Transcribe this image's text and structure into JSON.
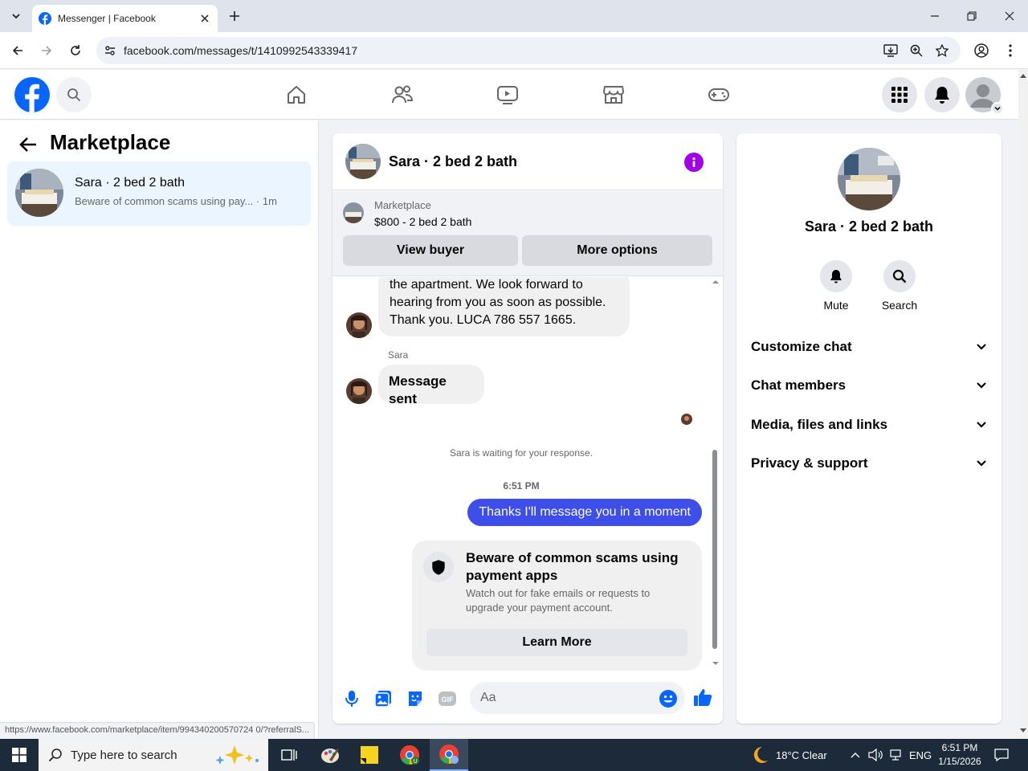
{
  "browser": {
    "tab_title": "Messenger | Facebook",
    "url": "facebook.com/messages/t/1410992543339417",
    "status_url": "https://www.facebook.com/marketplace/item/994340200570724 0/?referralS..."
  },
  "left_panel": {
    "title": "Marketplace",
    "conversation": {
      "name": "Sara · 2 bed 2 bath",
      "snippet": "Beware of common scams using pay...",
      "time": "· 1m"
    }
  },
  "chat": {
    "title": "Sara · 2 bed 2 bath",
    "marketplace_label": "Marketplace",
    "listing": "$800 - 2 bed 2 bath",
    "view_buyer": "View buyer",
    "more_options": "More options",
    "messages": {
      "partial_text": "the apartment. We look forward to hearing from you as soon as possible. Thank you. LUCA 786 557 1665.",
      "sender": "Sara",
      "message_sent": "Message sent",
      "waiting": "Sara is waiting for your response.",
      "time": "6:51 PM",
      "outgoing": "Thanks I'll message you in a moment",
      "scam_title": "Beware of common scams using payment apps",
      "scam_body": "Watch out for fake emails or requests to upgrade your payment account.",
      "learn_more": "Learn More"
    },
    "composer_placeholder": "Aa"
  },
  "right_panel": {
    "name": "Sara · 2 bed 2 bath",
    "mute": "Mute",
    "search": "Search",
    "rows": [
      "Customize chat",
      "Chat members",
      "Media, files and links",
      "Privacy & support"
    ]
  },
  "taskbar": {
    "search_placeholder": "Type here to search",
    "weather": "18°C  Clear",
    "lang": "ENG",
    "time": "6:51 PM",
    "date": "1/15/2026"
  },
  "colors": {
    "fb_blue": "#0866ff",
    "outgoing_bubble": "#3e4ee8",
    "info_purple": "#a100e6"
  }
}
